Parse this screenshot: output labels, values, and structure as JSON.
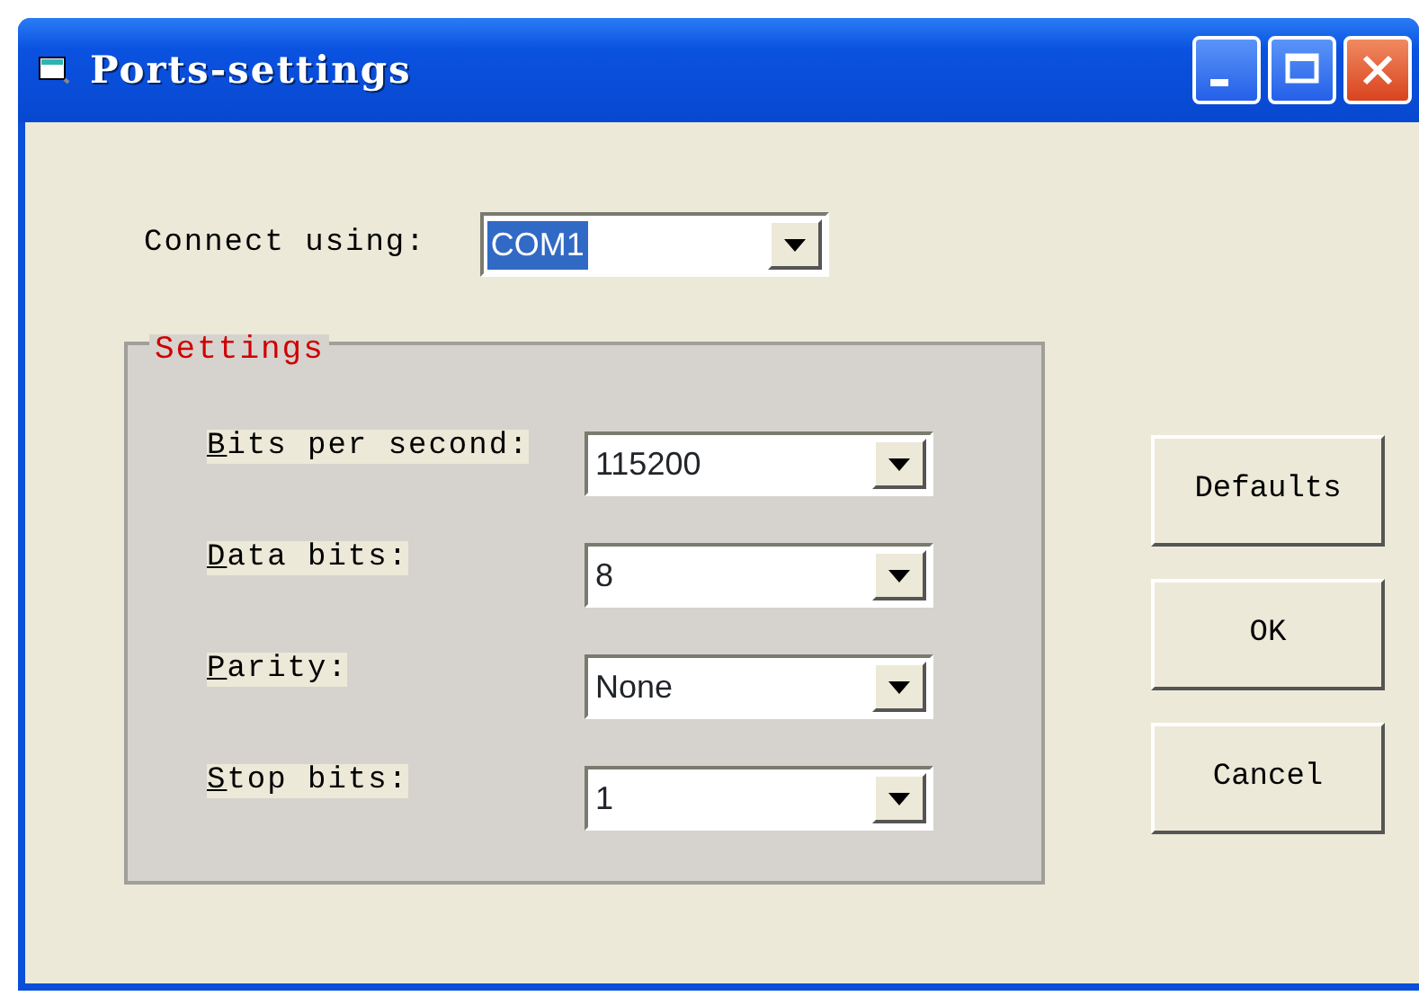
{
  "window": {
    "title": "Ports-settings"
  },
  "connect": {
    "label": "Connect using:",
    "value": "COM1",
    "text_selected": true
  },
  "settings": {
    "title": "Settings",
    "fields": [
      {
        "label": "Bits per second:",
        "value": "115200"
      },
      {
        "label": "Data bits:",
        "value": "8"
      },
      {
        "label": "Parity:",
        "value": "None"
      },
      {
        "label": "Stop bits:",
        "value": "1"
      }
    ]
  },
  "buttons": [
    "Defaults",
    "OK",
    "Cancel"
  ]
}
